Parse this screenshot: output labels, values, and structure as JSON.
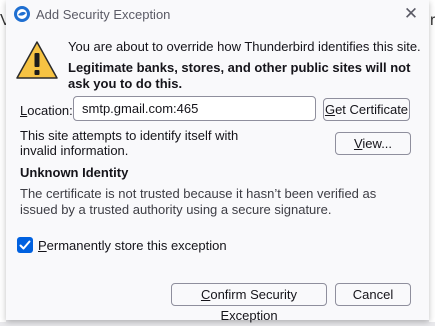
{
  "window": {
    "title": "Add Security Exception",
    "close_glyph": "✕"
  },
  "background": {
    "left_fragment": "V",
    "right_fragment": "r"
  },
  "warning": {
    "line1": "You are about to override how Thunderbird identifies this site.",
    "line2": "Legitimate banks, stores, and other public sites will not ask you to do this."
  },
  "location": {
    "label_prefix": "L",
    "label_rest": "ocation:",
    "value": "smtp.gmail.com:465"
  },
  "buttons": {
    "get_certificate_prefix": "G",
    "get_certificate_rest": "et Certificate",
    "view_prefix": "V",
    "view_rest": "iew...",
    "confirm_prefix": "C",
    "confirm_rest": "onfirm Security Exception",
    "cancel": "Cancel"
  },
  "attempt_text": "This site attempts to identify itself with invalid information.",
  "identity": {
    "heading": "Unknown Identity",
    "body": "The certificate is not trusted because it hasn’t been verified as issued by a trusted authority using a secure signature."
  },
  "permanent": {
    "checked": true,
    "label_prefix": "P",
    "label_rest": "ermanently store this exception"
  },
  "colors": {
    "accent": "#0061e0",
    "warning": "#f6c343"
  }
}
